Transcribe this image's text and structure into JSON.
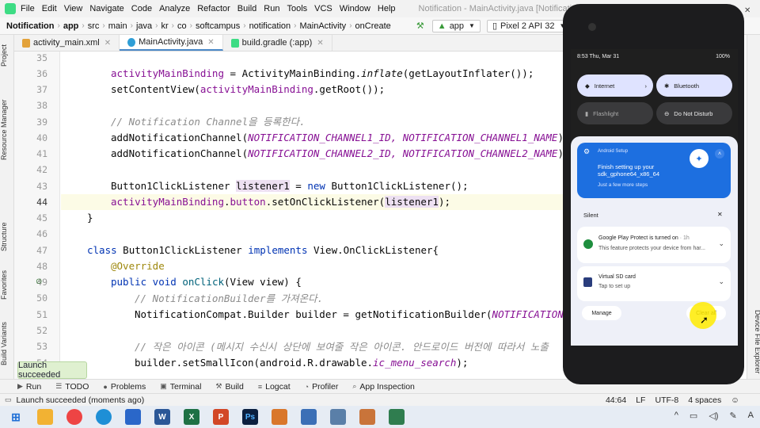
{
  "menubar": {
    "items": [
      "File",
      "Edit",
      "View",
      "Navigate",
      "Code",
      "Analyze",
      "Refactor",
      "Build",
      "Run",
      "Tools",
      "VCS",
      "Window",
      "Help"
    ],
    "window_title": "Notification - MainActivity.java [Notification.app]"
  },
  "navbar": {
    "crumbs": [
      "Notification",
      "app",
      "src",
      "main",
      "java",
      "kr",
      "co",
      "softcampus",
      "notification",
      "MainActivity",
      "onCreate"
    ],
    "run_config": "app",
    "device": "Pixel 2 API 32"
  },
  "tabs": [
    {
      "label": "activity_main.xml",
      "color": "#e3a23a"
    },
    {
      "label": "MainActivity.java",
      "color": "#2f9ed6"
    },
    {
      "label": "build.gradle (:app)",
      "color": "#3ddc84"
    }
  ],
  "left_tools": [
    "Project",
    "Resource Manager",
    "Structure",
    "Favorites",
    "Build Variants"
  ],
  "right_tools": [
    "Device File Explorer"
  ],
  "code": {
    "line_numbers": [
      "35",
      "36",
      "37",
      "38",
      "39",
      "40",
      "41",
      "42",
      "43",
      "44",
      "45",
      "46",
      "47",
      "48",
      "49",
      "50",
      "51",
      "52",
      "53",
      "54"
    ],
    "lines": {
      "l36a": "activityMainBinding",
      "l36b": " = ActivityMainBinding.",
      "l36c": "inflate",
      "l36d": "(getLayoutInflater());",
      "l37a": "setContentView(",
      "l37b": "activityMainBinding",
      "l37c": ".getRoot());",
      "l39": "// Notification Channel을 등록한다.",
      "l40a": "addNotificationChannel(",
      "l40b": "NOTIFICATION_CHANNEL1_ID, NOTIFICATION_CHANNEL1_NAME",
      "l40c": ");",
      "l41a": "addNotificationChannel(",
      "l41b": "NOTIFICATION_CHANNEL2_ID, NOTIFICATION_CHANNEL2_NAME",
      "l41c": ");",
      "l43a": "Button1ClickListener ",
      "l43b": "listener1",
      "l43c": " = ",
      "l43d": "new",
      "l43e": " Button1ClickListener();",
      "l44a": "activityMainBinding",
      "l44b": ".",
      "l44c": "button",
      "l44d": ".setOnClickListener(",
      "l44e": "listener1",
      "l44f": ");",
      "l45": "}",
      "l47a": "class",
      "l47b": " Button1ClickListener ",
      "l47c": "implements",
      "l47d": " View.OnClickListener{",
      "l48": "@Override",
      "l49a": "public void",
      "l49b": " onClick",
      "l49c": "(View view) {",
      "l50": "// NotificationBuilder를 가져온다.",
      "l51a": "NotificationCompat.Builder builder = getNotificationBuilder(",
      "l51b": "NOTIFICATION",
      "l53": "// 작은 아이콘 (메시지 수신시 상단에 보여줄 작은 아이콘. 안드로이드 버전에 따라서 노출",
      "l54a": "builder.setSmallIcon(android.R.drawable.",
      "l54b": "ic_menu_search",
      "l54c": ");"
    }
  },
  "toast": "Launch succeeded",
  "bottom_tools": [
    "Run",
    "TODO",
    "Problems",
    "Terminal",
    "Build",
    "Logcat",
    "Profiler",
    "App Inspection"
  ],
  "status": {
    "message": "Launch succeeded (moments ago)",
    "position": "44:64",
    "line_sep": "LF",
    "encoding": "UTF-8",
    "indent": "4 spaces"
  },
  "phone": {
    "time": "8:53 Thu, Mar 31",
    "battery": "100%",
    "tiles": [
      "Internet",
      "Bluetooth",
      "Flashlight",
      "Do Not Disturb"
    ],
    "setup_card": {
      "app": "Android Setup",
      "title": "Finish setting up your sdk_gphone64_x86_64",
      "subtitle": "Just a few more steps"
    },
    "silent_label": "Silent",
    "notifications": [
      {
        "title": "Google Play Protect is turned on",
        "time": "· 1h",
        "body": "This feature protects your device from har..."
      },
      {
        "title": "Virtual SD card",
        "body": "Tap to set up"
      }
    ],
    "manage": "Manage",
    "clear_all": "Clear all"
  },
  "taskbar_apps": [
    "File Explorer",
    "Chrome",
    "Edge",
    "Notepad",
    "Word",
    "Excel",
    "PowerPoint",
    "Photoshop",
    "App",
    "Notepad2",
    "Calculator",
    "Snipping",
    "Android Studio"
  ]
}
